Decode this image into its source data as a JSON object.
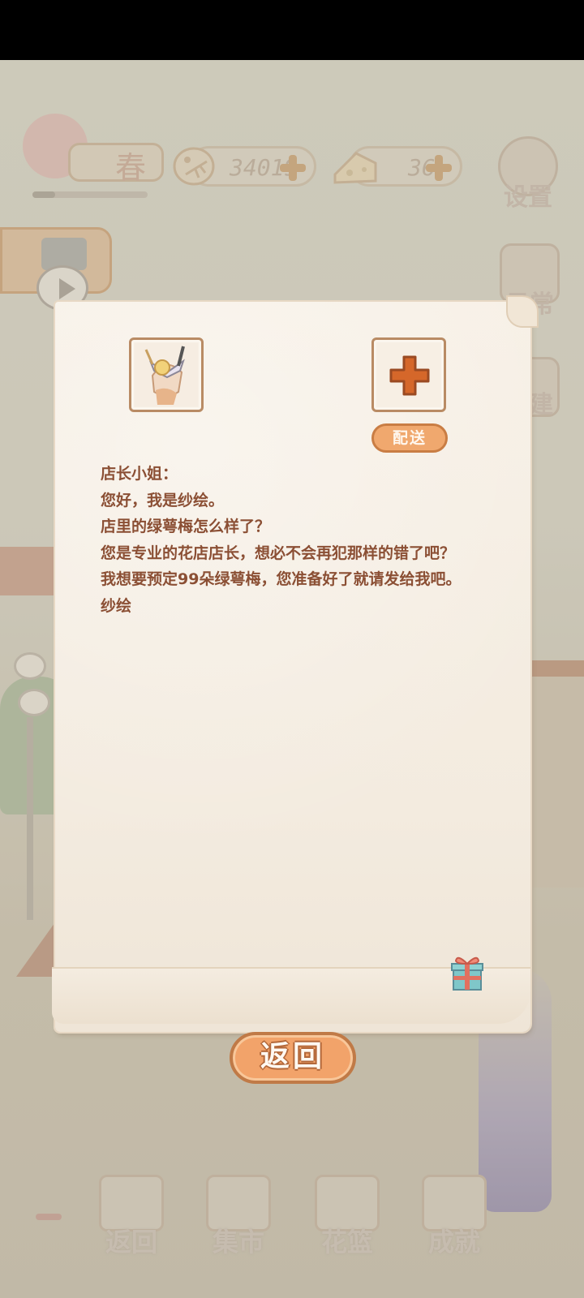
{
  "hud": {
    "season_label": "春",
    "season_progress": 0.2,
    "fish_currency": "34019",
    "cheese_currency": "36",
    "settings_label": "设置",
    "daily_label": "日常",
    "build_label": "建"
  },
  "letter": {
    "deliver_label": "配送",
    "lines": [
      "店长小姐：",
      "您好，我是纱绘。",
      "店里的绿萼梅怎么样了？",
      "您是专业的花店店长，想必不会再犯那样的错了吧？",
      "我想要预定99朵绿萼梅，您准备好了就请发给我吧。",
      "纱绘"
    ]
  },
  "back_button": "返回",
  "bottom_nav": [
    {
      "label": "返回",
      "icon": "window-icon"
    },
    {
      "label": "集市",
      "icon": "market-stall-icon"
    },
    {
      "label": "花篮",
      "icon": "flower-basket-icon"
    },
    {
      "label": "成就",
      "icon": "trophy-icon"
    }
  ],
  "colors": {
    "letter_text": "#8b4f34",
    "accent_orange": "#f2a36a",
    "accent_border": "#c07a47",
    "paper": "#f5eee3"
  }
}
